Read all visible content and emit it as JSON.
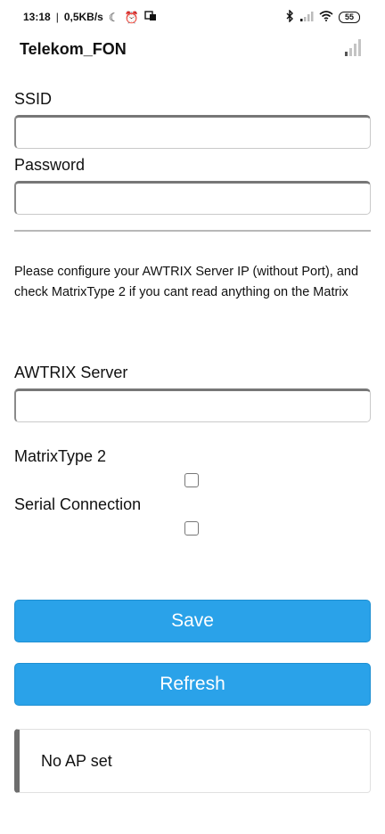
{
  "status_bar": {
    "time": "13:18",
    "separator": "|",
    "net_speed": "0,5KB/s",
    "battery": "55"
  },
  "network": {
    "name": "Telekom_FON",
    "signal_icon": "signal-bars-icon"
  },
  "form": {
    "ssid_label": "SSID",
    "ssid_value": "",
    "password_label": "Password",
    "password_value": "",
    "info_text": "Please configure your AWTRIX Server IP (without Port), and check MatrixType 2 if you cant read anything on the Matrix",
    "server_label": "AWTRIX Server",
    "server_value": "",
    "matrixtype_label": "MatrixType 2",
    "matrixtype_checked": false,
    "serial_label": "Serial Connection",
    "serial_checked": false
  },
  "buttons": {
    "save_label": "Save",
    "refresh_label": "Refresh"
  },
  "message": {
    "text": "No AP set"
  },
  "colors": {
    "button_bg": "#2aa2e9",
    "message_accent": "#6d6d6d"
  }
}
